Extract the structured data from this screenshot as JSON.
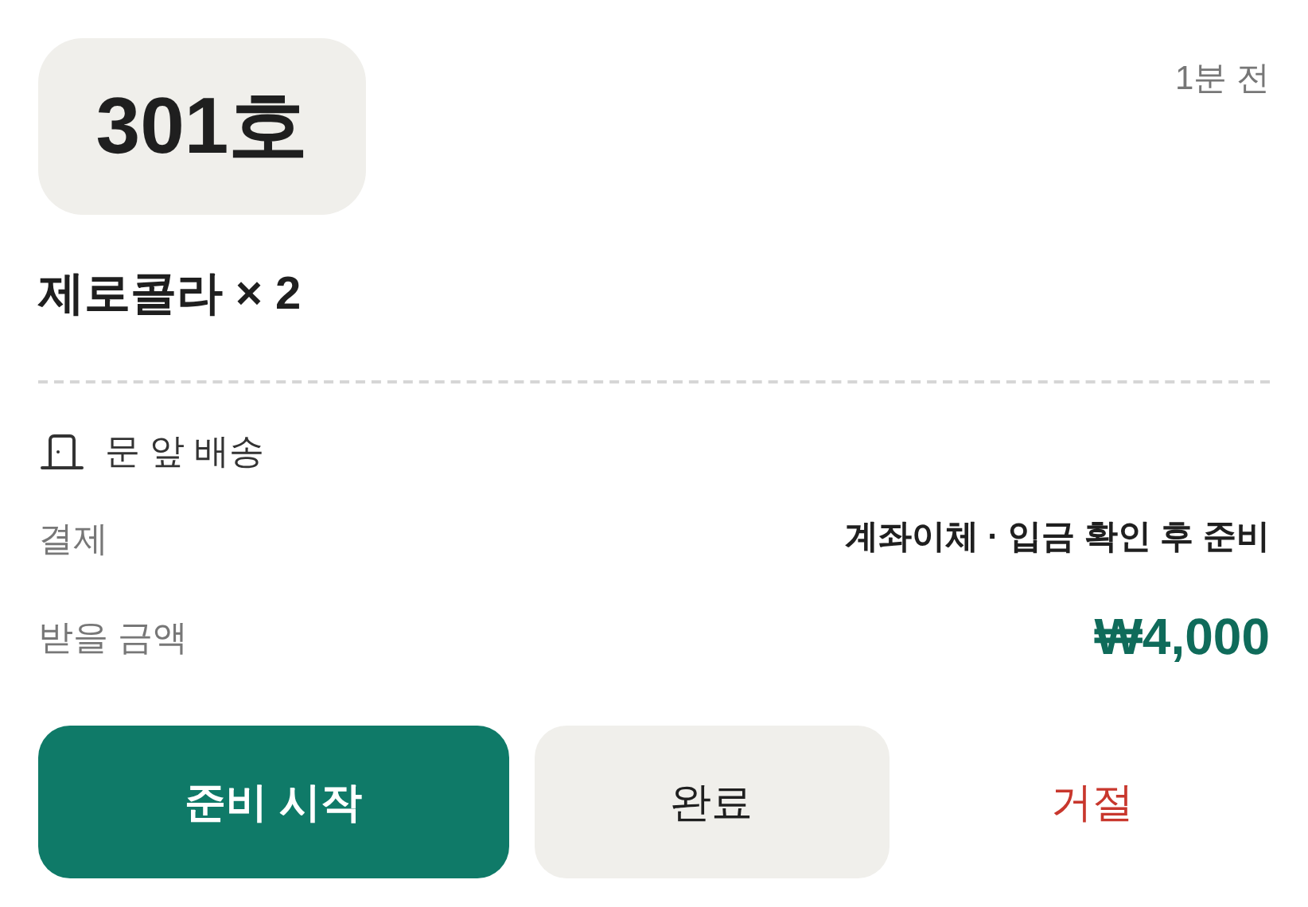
{
  "room": "301호",
  "time": "1분 전",
  "item": "제로콜라 × 2",
  "delivery": {
    "label": "문 앞 배송"
  },
  "rows": [
    {
      "label": "결제",
      "value": "계좌이체 · 입금 확인 후 준비",
      "kind": "text"
    },
    {
      "label": "받을 금액",
      "value": "₩4,000",
      "kind": "amount"
    }
  ],
  "buttons": [
    {
      "label": "준비 시작",
      "kind": "primary"
    },
    {
      "label": "완료",
      "kind": "secondary"
    },
    {
      "label": "거절",
      "kind": "danger"
    }
  ]
}
